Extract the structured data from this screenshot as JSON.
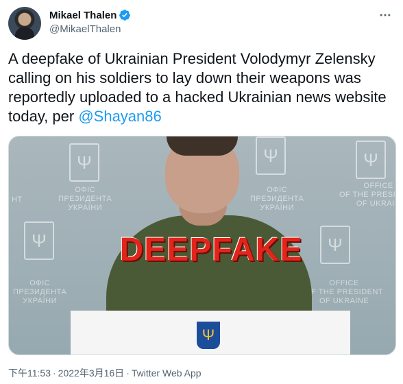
{
  "author": {
    "display_name": "Mikael Thalen",
    "handle": "@MikaelThalen"
  },
  "tweet": {
    "text_before": "A deepfake of Ukrainian President Volodymyr Zelensky calling on his soldiers to lay down their weapons was reportedly uploaded to a hacked Ukrainian news website today, per ",
    "mention": "@Shayan86"
  },
  "media": {
    "overlay_text": "DEEPFAKE",
    "wall_texts": [
      "НТ",
      "ОФІС\nПРЕЗИДЕНТА\nУКРАЇНИ",
      "ОФІС\nПРЕЗИДЕНТА\nУКРАЇНИ",
      "OFFICE\nOF THE PRESIDENT\nOF UKRAIN",
      "ОФІС\nПРЕЗИДЕНТА\nУКРАЇНИ",
      "OFFICE\nOF THE PRESIDENT\nOF UKRAINE"
    ]
  },
  "meta": {
    "time": "下午11:53",
    "date": "2022年3月16日",
    "source": "Twitter Web App"
  },
  "colors": {
    "link": "#1d9bf0",
    "secondary_text": "#536471",
    "overlay_red": "#e2251b"
  },
  "icons": [
    "verified-badge-icon",
    "more-options-icon",
    "trident-icon"
  ]
}
